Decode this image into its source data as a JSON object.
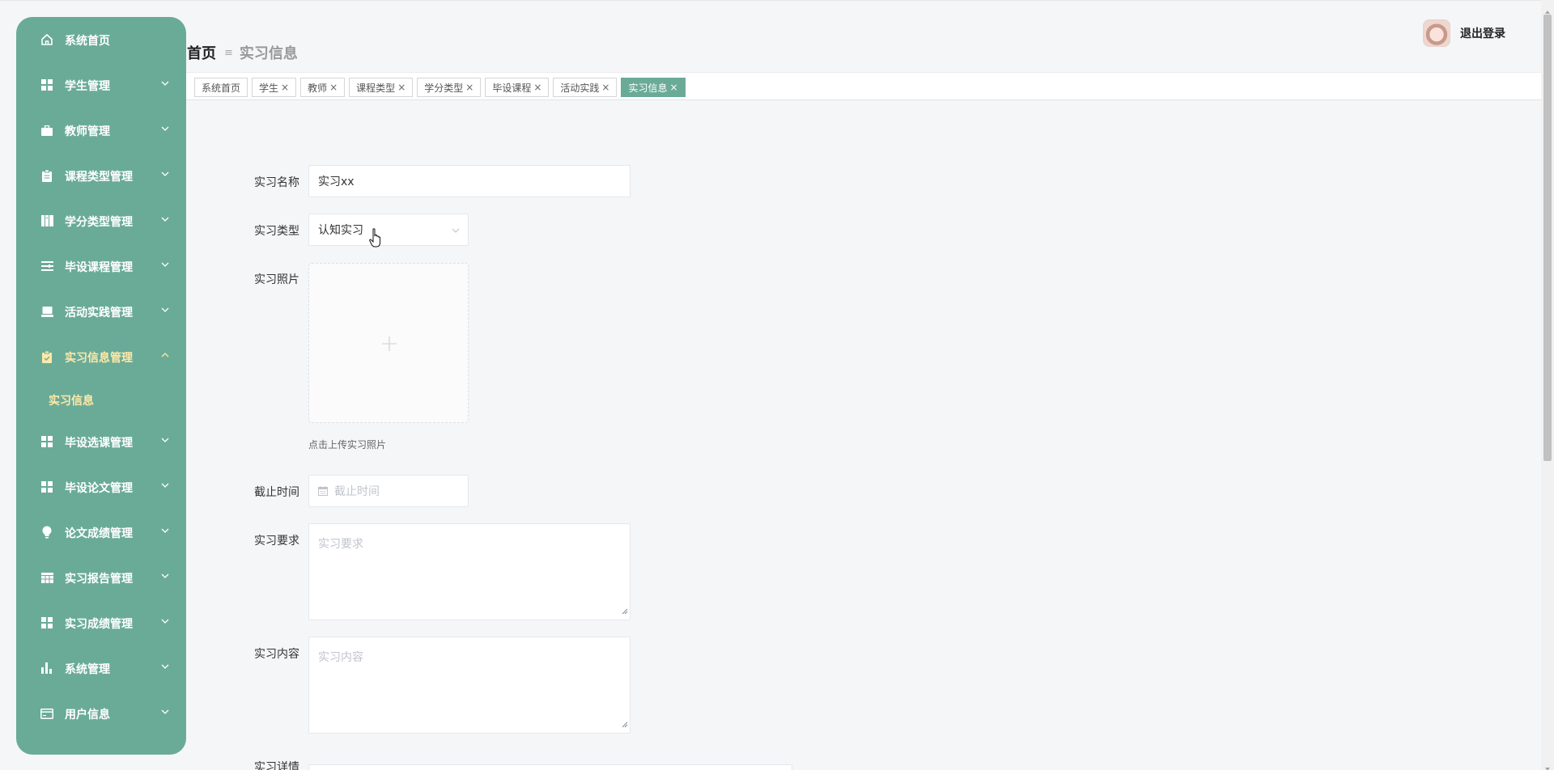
{
  "sidebar": {
    "items": [
      {
        "label": "系统首页",
        "icon": "home-icon"
      },
      {
        "label": "学生管理",
        "icon": "grid-icon"
      },
      {
        "label": "教师管理",
        "icon": "briefcase-icon"
      },
      {
        "label": "课程类型管理",
        "icon": "clipboard-icon"
      },
      {
        "label": "学分类型管理",
        "icon": "book-icon"
      },
      {
        "label": "毕设课程管理",
        "icon": "list-icon"
      },
      {
        "label": "活动实践管理",
        "icon": "laptop-icon"
      },
      {
        "label": "实习信息管理",
        "icon": "clipboard-check-icon"
      },
      {
        "label": "毕设选课管理",
        "icon": "grid-icon"
      },
      {
        "label": "毕设论文管理",
        "icon": "grid-icon"
      },
      {
        "label": "论文成绩管理",
        "icon": "lightbulb-icon"
      },
      {
        "label": "实习报告管理",
        "icon": "table-icon"
      },
      {
        "label": "实习成绩管理",
        "icon": "grid-icon"
      },
      {
        "label": "系统管理",
        "icon": "bar-chart-icon"
      },
      {
        "label": "用户信息",
        "icon": "card-icon"
      }
    ],
    "submenu": {
      "label": "实习信息"
    },
    "colors": {
      "background": "#6aab98",
      "text": "#ffffff",
      "active_text": "#ffe9a8"
    }
  },
  "header": {
    "breadcrumb_home": "首页",
    "breadcrumb_separator": "≡",
    "breadcrumb_current": "实习信息",
    "logout_label": "退出登录"
  },
  "tabs": [
    {
      "label": "系统首页",
      "closable": false,
      "active": false
    },
    {
      "label": "学生",
      "closable": true,
      "active": false
    },
    {
      "label": "教师",
      "closable": true,
      "active": false
    },
    {
      "label": "课程类型",
      "closable": true,
      "active": false
    },
    {
      "label": "学分类型",
      "closable": true,
      "active": false
    },
    {
      "label": "毕设课程",
      "closable": true,
      "active": false
    },
    {
      "label": "活动实践",
      "closable": true,
      "active": false
    },
    {
      "label": "实习信息",
      "closable": true,
      "active": true
    }
  ],
  "tab_close_glyph": "×",
  "form": {
    "name": {
      "label": "实习名称",
      "value": "实习xx"
    },
    "type": {
      "label": "实习类型",
      "value": "认知实习"
    },
    "photo": {
      "label": "实习照片",
      "tip": "点击上传实习照片"
    },
    "deadline": {
      "label": "截止时间",
      "placeholder": "截止时间"
    },
    "requirement": {
      "label": "实习要求",
      "placeholder": "实习要求"
    },
    "content": {
      "label": "实习内容",
      "placeholder": "实习内容"
    },
    "detail": {
      "label": "实习详情"
    }
  }
}
